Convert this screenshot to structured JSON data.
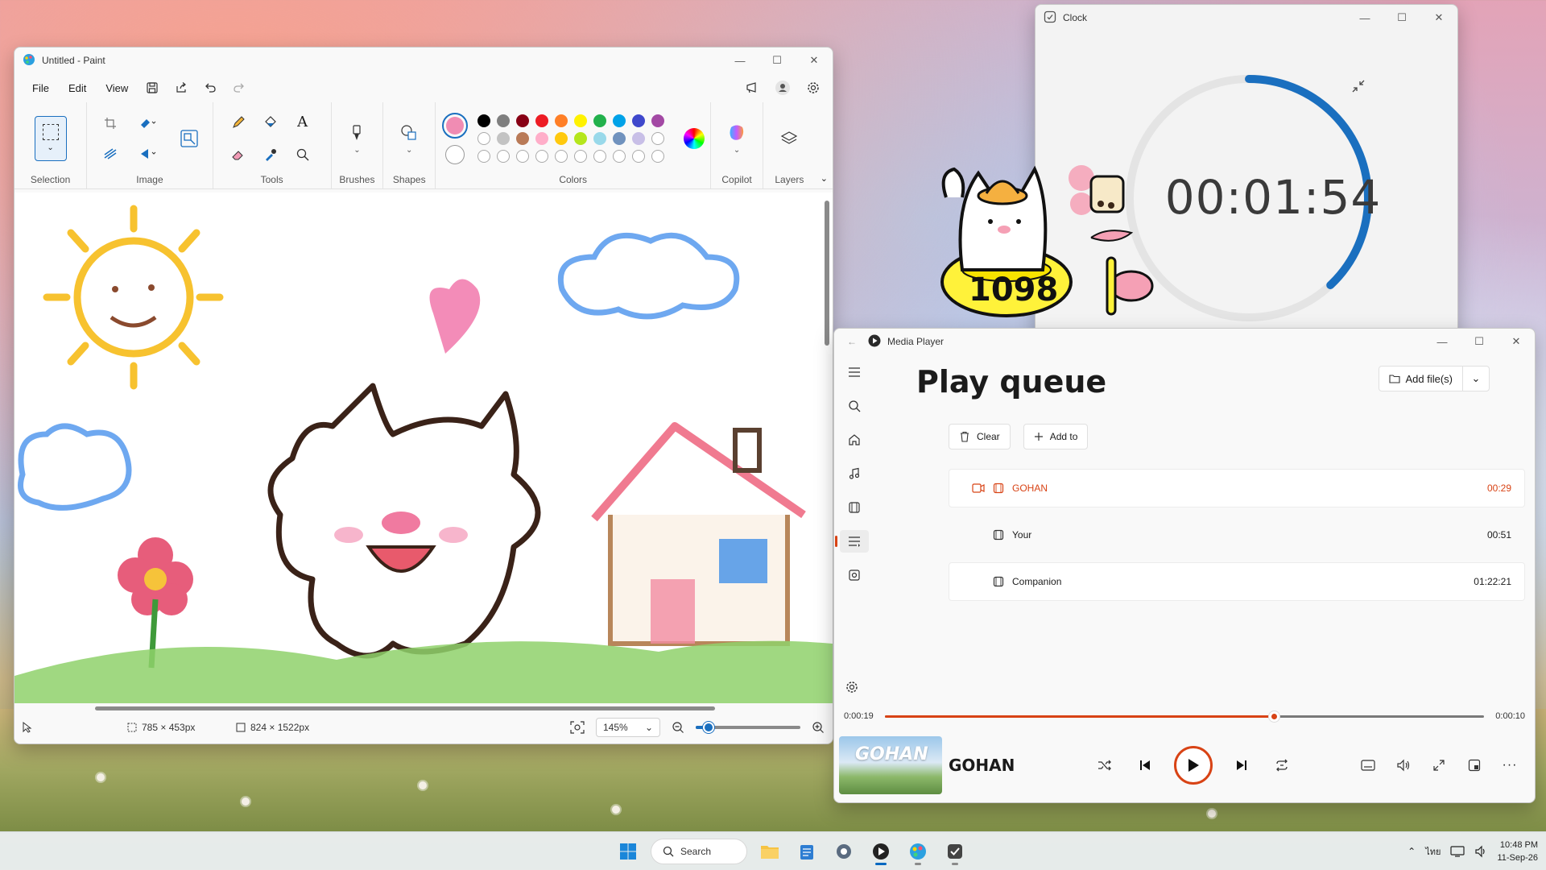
{
  "paint": {
    "title": "Untitled - Paint",
    "menu": [
      "File",
      "Edit",
      "View"
    ],
    "groups": {
      "selection": "Selection",
      "image": "Image",
      "tools": "Tools",
      "brushes": "Brushes",
      "shapes": "Shapes",
      "colors": "Colors",
      "copilot": "Copilot",
      "layers": "Layers"
    },
    "primary_color": "#f08cb3",
    "swatch_row1": [
      "#000000",
      "#7f7f7f",
      "#880015",
      "#ed1c24",
      "#ff7f27",
      "#fff200",
      "#22b14c",
      "#00a2e8",
      "#3f48cc",
      "#a349a4"
    ],
    "swatch_row2": [
      "#ffffff",
      "#c3c3c3",
      "#b97a57",
      "#ffaec9",
      "#ffc90e",
      "#b5e61d",
      "#99d9ea",
      "#7092be",
      "#c8bfe7",
      "#ffffff"
    ],
    "status": {
      "selection_size": "785 × 453px",
      "canvas_size": "824 × 1522px",
      "zoom": "145%",
      "zoom_fraction": 0.12
    }
  },
  "clock": {
    "title": "Clock",
    "timer": "00:01:54",
    "ring_progress": 0.38
  },
  "sticker": {
    "count": "1098"
  },
  "media": {
    "title": "Media Player",
    "heading": "Play queue",
    "add_files": "Add file(s)",
    "clear": "Clear",
    "add_to": "Add to",
    "queue": [
      {
        "title": "GOHAN",
        "duration": "00:29"
      },
      {
        "title": "Your",
        "duration": "00:51"
      },
      {
        "title": "Companion",
        "duration": "01:22:21"
      }
    ],
    "elapsed": "0:00:19",
    "remaining": "0:00:10",
    "progress": 0.65,
    "now_playing": "GOHAN",
    "album_text": "GOHAN"
  },
  "taskbar": {
    "search": "Search",
    "time": "10:48 PM",
    "date": "11-Sep-26",
    "lang": "ไทย"
  }
}
